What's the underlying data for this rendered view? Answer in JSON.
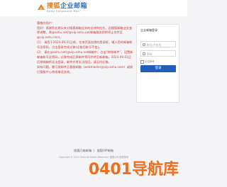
{
  "header": {
    "logo_text_1": "搜狐",
    "logo_text_2": "企业邮箱",
    "logo_sub": "Sohu Corporate Mail"
  },
  "notice": {
    "greeting": "尊敬的用户：",
    "p1": "您好！感谢您长期以来对搜狐邮箱业务的支持和信任。因搜狐邮箱业务变更调整，原@sohu.net/@vip.sohu.net邮箱服务即将停止合并至@vip.sohu.com。",
    "p2": "(1)　请您于2024.09.01日前，在本页面右侧的登录框，输入您的邮箱帐号及密码，点击登录完成迁移(迁移后帐号不变)。",
    "p3": "(2)　请在@sohu.net/@vip.sohu.net邮箱中，点击“转移邮件”，设置新邮箱帐号及密码，迁移完成后原邮件将同步转至新邮箱，2024.09.01日后原邮箱将无法登录，邮件亦将无法找回，请及时迁移。",
    "p4": "如有问题，敬可发邮件至客服邮箱（webmaster@vip.sohu.com）或拨打客服中心热线电话咨询。"
  },
  "login": {
    "title": "企业邮箱登录",
    "username_placeholder": "帐号/手机号",
    "password_placeholder": "密码",
    "remember": "记住帐号",
    "submit_label": "登录"
  },
  "footer": {
    "link1": "搜狐闪电邮箱",
    "link2": "搜狐VIP邮箱",
    "copyright": "Copyright © 2024 Sohu All Rights Reserved. 搜狐公司 版权所有"
  },
  "watermark": {
    "text": "0401导航库"
  },
  "colors": {
    "accent": "#e8790b",
    "notice_text": "#c63b3b",
    "button": "#1f5fb8",
    "watermark": "#ef6e1d"
  }
}
